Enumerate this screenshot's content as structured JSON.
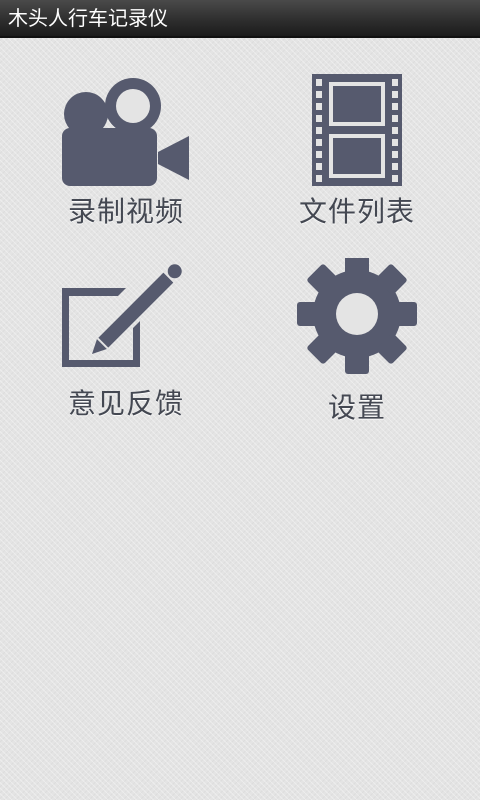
{
  "app": {
    "title": "木头人行车记录仪"
  },
  "menu": {
    "items": [
      {
        "label": "录制视频",
        "icon": "video-camera-icon"
      },
      {
        "label": "文件列表",
        "icon": "film-strip-icon"
      },
      {
        "label": "意见反馈",
        "icon": "edit-pencil-icon"
      },
      {
        "label": "设置",
        "icon": "gear-icon"
      }
    ]
  },
  "colors": {
    "icon": "#565a6e",
    "label": "#444852",
    "titlebar": "#2c2c2c",
    "background": "#e4e4e4"
  }
}
